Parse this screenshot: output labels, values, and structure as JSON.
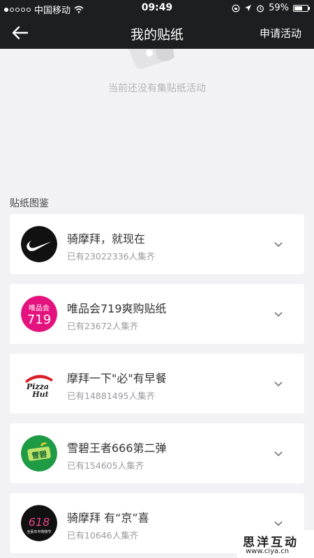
{
  "status_bar": {
    "carrier": "中国移动",
    "time": "09:49",
    "battery": "59%",
    "battery_level": 0.59,
    "signal_bars": 1
  },
  "nav": {
    "title": "我的贴纸",
    "action": "申请活动"
  },
  "empty": {
    "message": "当前还没有集贴纸活动"
  },
  "section": {
    "title": "贴纸图鉴"
  },
  "stickers": [
    {
      "name": "骑摩拜，就现在",
      "count": "已有23022336人集齐",
      "logo": "nike-swoosh-logo"
    },
    {
      "name": "唯品会719爽购贴纸",
      "count": "已有23672人集齐",
      "logo": "vip-719-logo",
      "logo_text_1": "唯品会",
      "logo_text_2": "719"
    },
    {
      "name": "摩拜一下\"必\"有早餐",
      "count": "已有14881495人集齐",
      "logo": "pizza-hut-logo",
      "logo_text_1": "Pizza",
      "logo_text_2": "Hut"
    },
    {
      "name": "雪碧王者666第二弹",
      "count": "已有154605人集齐",
      "logo": "sprite-logo",
      "logo_text_1": "雪碧"
    },
    {
      "name": "骑摩拜 有“京”喜",
      "count": "已有10646人集齐",
      "logo": "jd-618-logo",
      "logo_text_1": "618",
      "logo_text_2": "全民年中购物节"
    }
  ],
  "watermark": {
    "big": "思洋互动",
    "small": "www.ciya.cn"
  },
  "colors": {
    "nav_bg": "#1d1e22",
    "page_bg": "#f2f2f4",
    "vip_pink": "#e4127e",
    "sprite_green": "#1f9a45"
  }
}
